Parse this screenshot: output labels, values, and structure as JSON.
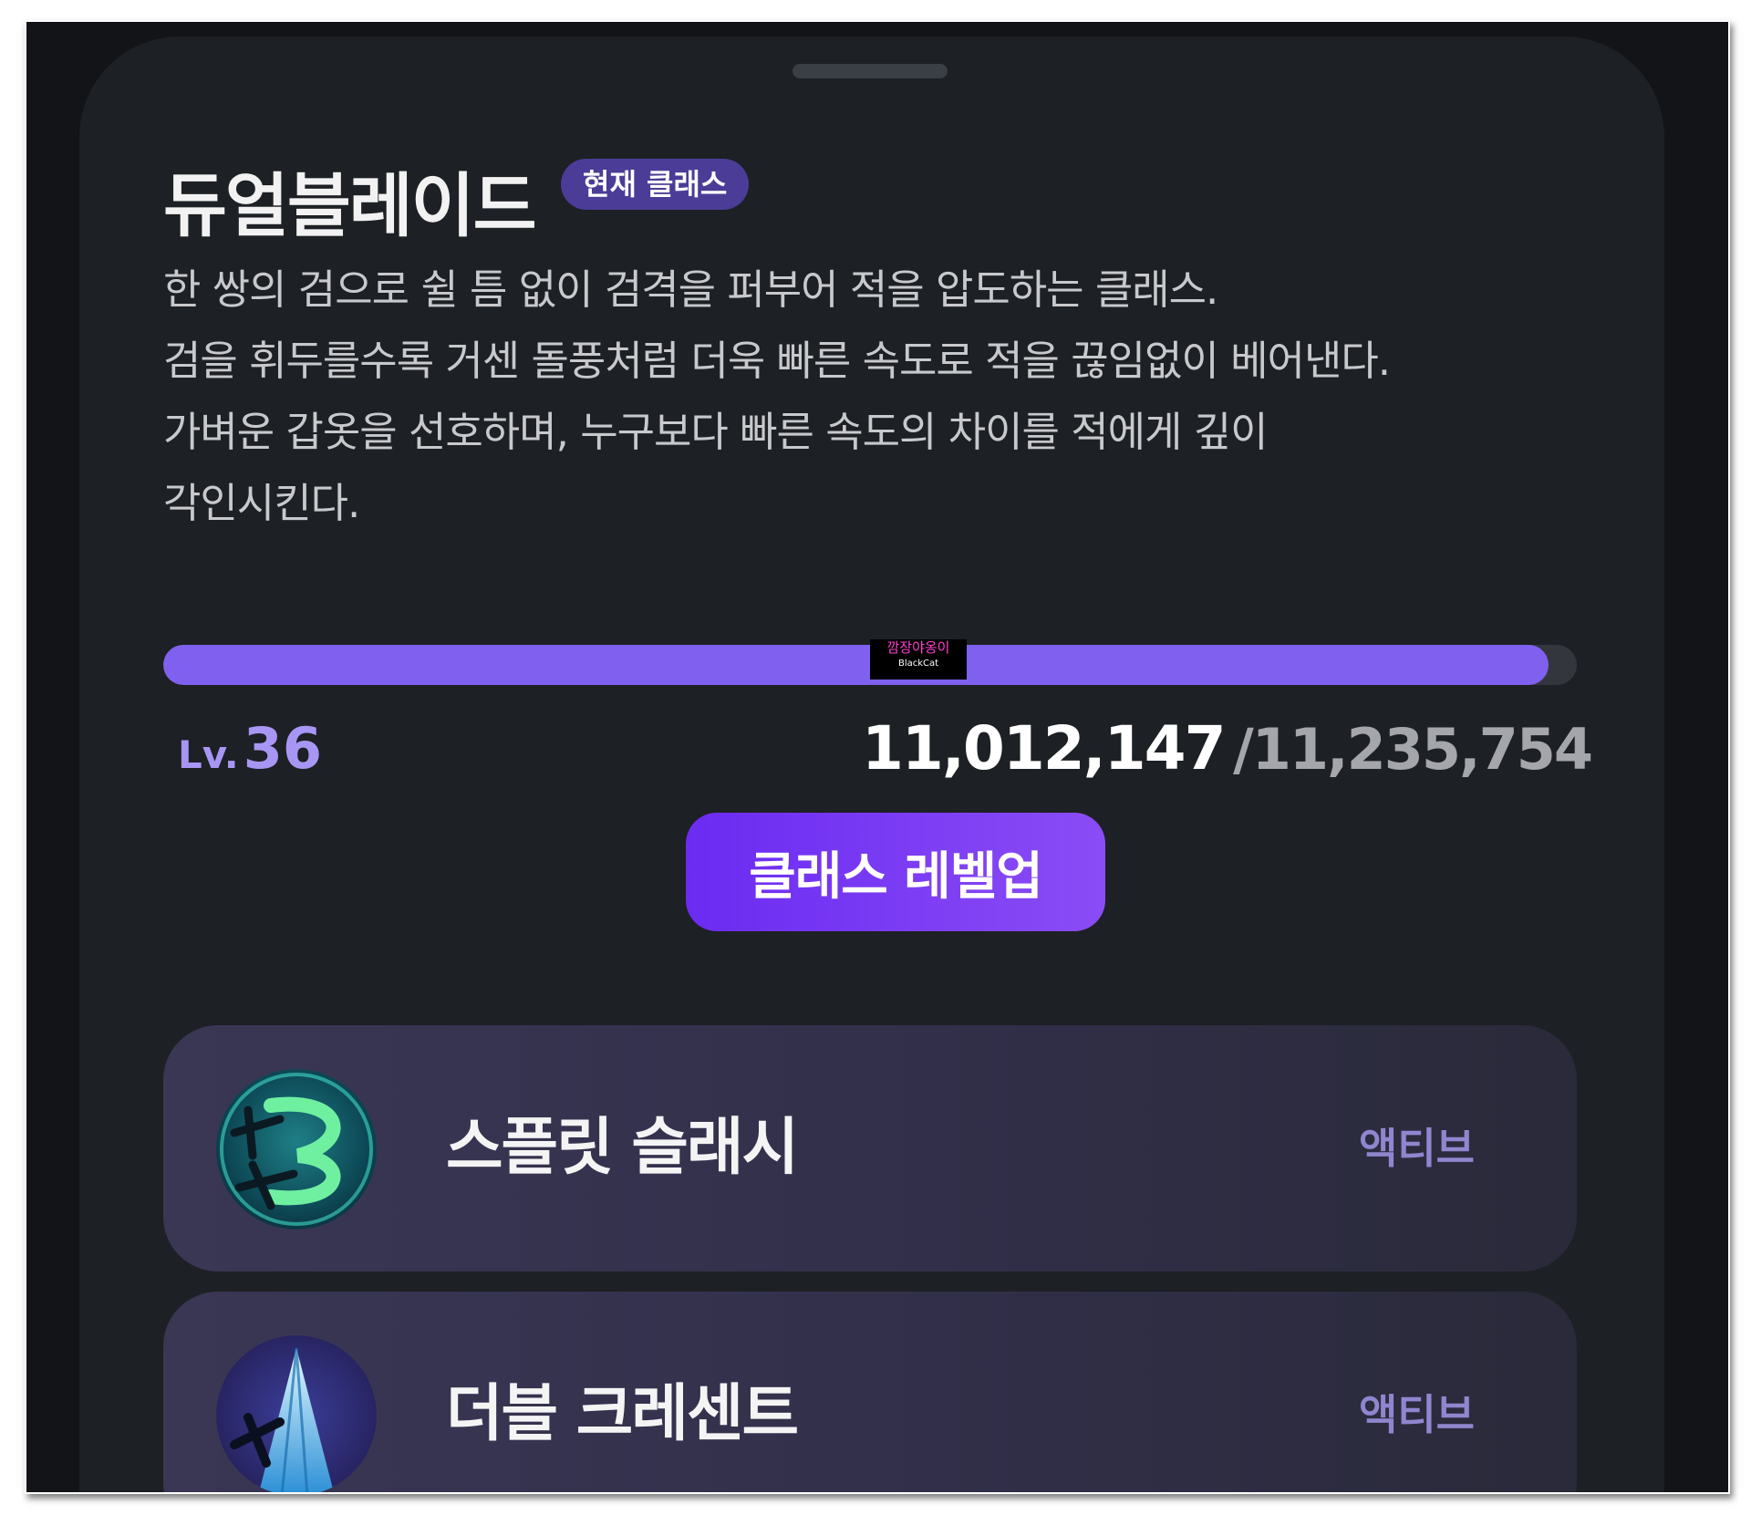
{
  "class": {
    "name": "듀얼블레이드",
    "badge": "현재 클래스",
    "description_lines": [
      "한 쌍의 검으로 쉴 틈 없이 검격을 퍼부어 적을 압도하는 클래스.",
      "검을 휘두를수록 거센 돌풍처럼 더욱 빠른 속도로 적을 끊임없이 베어낸다.",
      "가벼운 갑옷을 선호하며, 누구보다 빠른 속도의 차이를 적에게 깊이",
      "각인시킨다."
    ]
  },
  "progress": {
    "level_prefix": "Lv.",
    "level": "36",
    "current_exp": "11,012,147",
    "separator": "/",
    "max_exp": "11,235,754",
    "fill_fraction": 0.98
  },
  "watermark": {
    "text": "깜장야옹이",
    "sub": "BlackCat"
  },
  "levelup_button": {
    "label": "클래스 레벨업"
  },
  "skills": [
    {
      "name": "스플릿 슬래시",
      "type": "액티브",
      "icon": "split-slash-icon"
    },
    {
      "name": "더블 크레센트",
      "type": "액티브",
      "icon": "double-crescent-icon"
    }
  ],
  "colors": {
    "accent": "#8060ee",
    "badge": "#4b3c97",
    "level_text": "#a896f5",
    "skill_type": "#8f86cf"
  }
}
